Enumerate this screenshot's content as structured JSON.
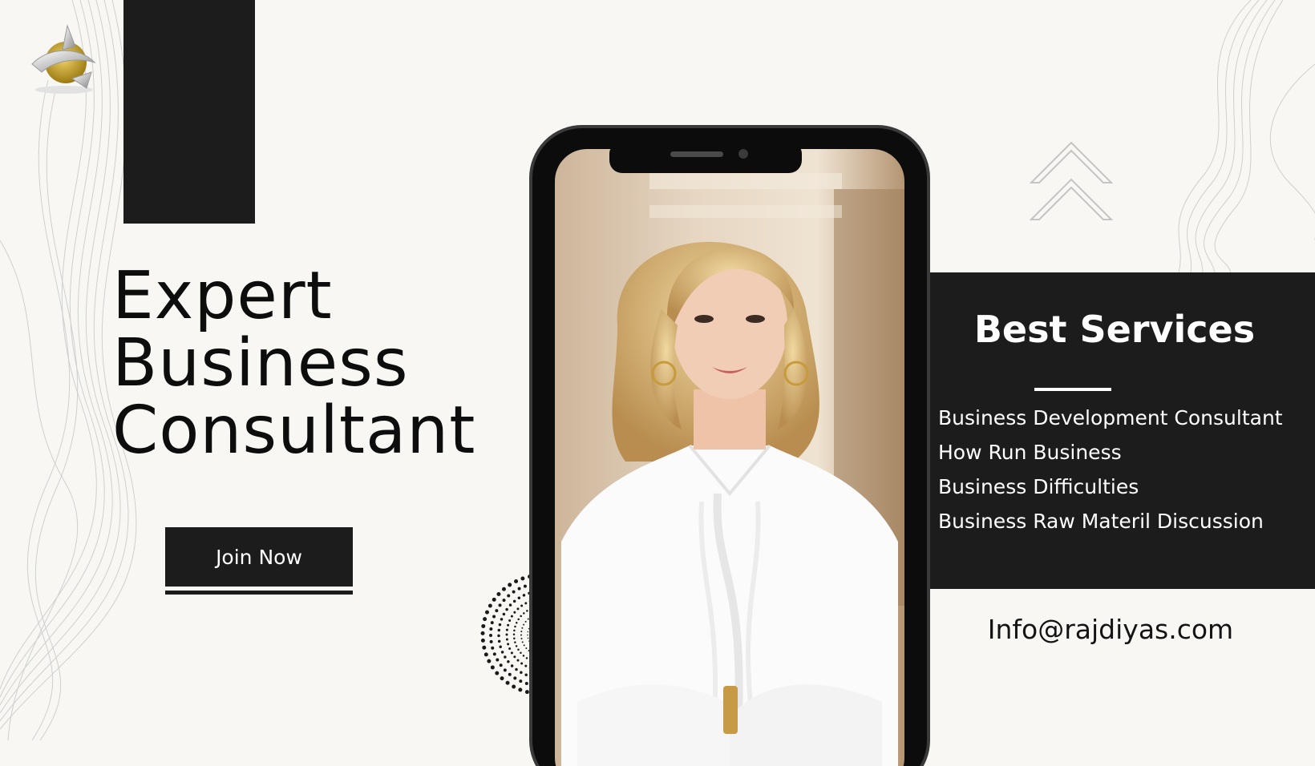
{
  "headline": {
    "line1": "Expert",
    "line2": "Business",
    "line3": "Consultant"
  },
  "cta": {
    "join_label": "Join Now"
  },
  "services": {
    "title": "Best Services",
    "items": [
      "Business Development Consultant",
      "How Run Business",
      "Business Difficulties",
      "Business Raw Materil Discussion"
    ]
  },
  "contact": {
    "email": "Info@rajdiyas.com"
  },
  "colors": {
    "background": "#f8f7f4",
    "dark": "#1c1c1c",
    "text": "#0d0d0d",
    "light_text": "#ffffff",
    "logo_gold": "#c9a227"
  },
  "icons": {
    "logo": "gold-silver-orb-logo",
    "chevrons": "double-chevron-up-icon",
    "dots": "dotted-circle-pattern"
  }
}
